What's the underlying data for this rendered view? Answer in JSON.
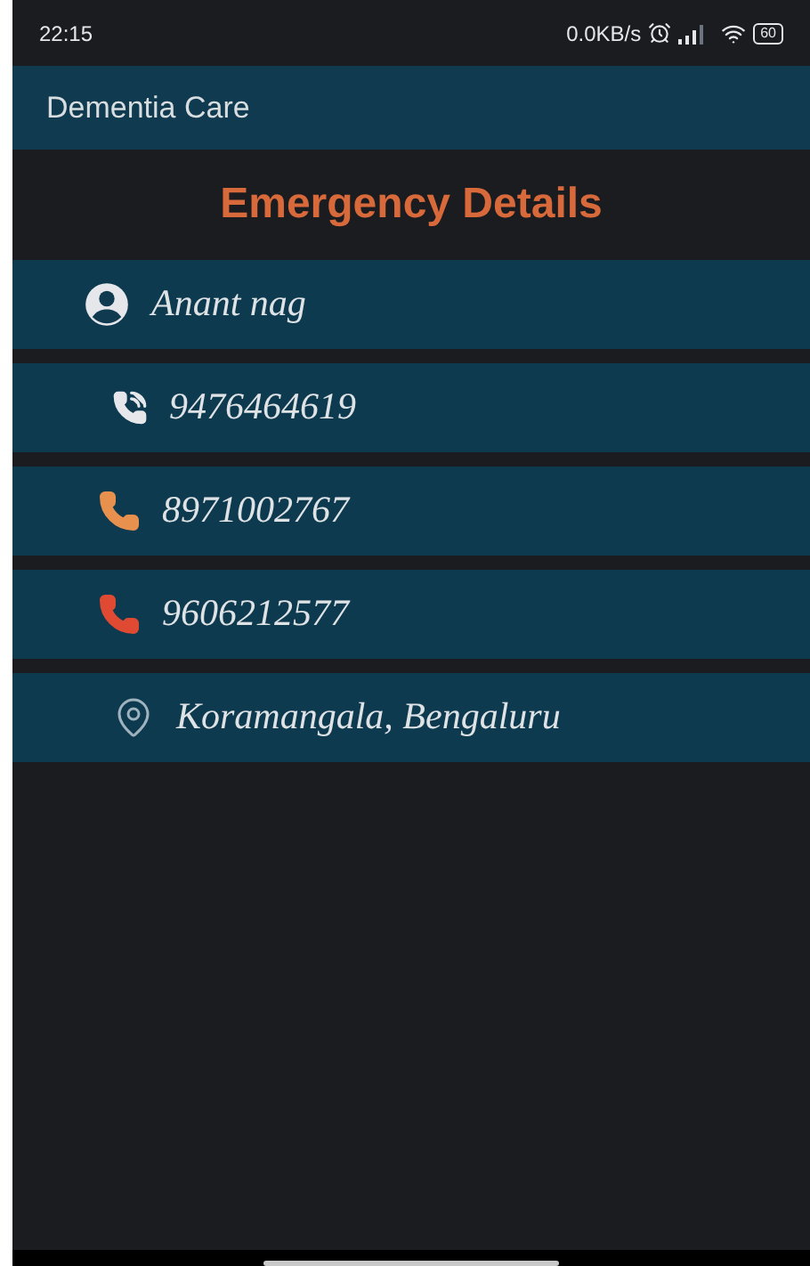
{
  "status_bar": {
    "time": "22:15",
    "speed": "0.0KB/s",
    "battery": "60"
  },
  "app_bar": {
    "title": "Dementia Care"
  },
  "heading": "Emergency Details",
  "details": [
    {
      "kind": "person",
      "text": "Anant nag"
    },
    {
      "kind": "phone-ring",
      "text": "9476464619"
    },
    {
      "kind": "phone-orange",
      "text": "8971002767"
    },
    {
      "kind": "phone-red",
      "text": "9606212577"
    },
    {
      "kind": "location",
      "text": "Koramangala, Bengaluru"
    }
  ]
}
